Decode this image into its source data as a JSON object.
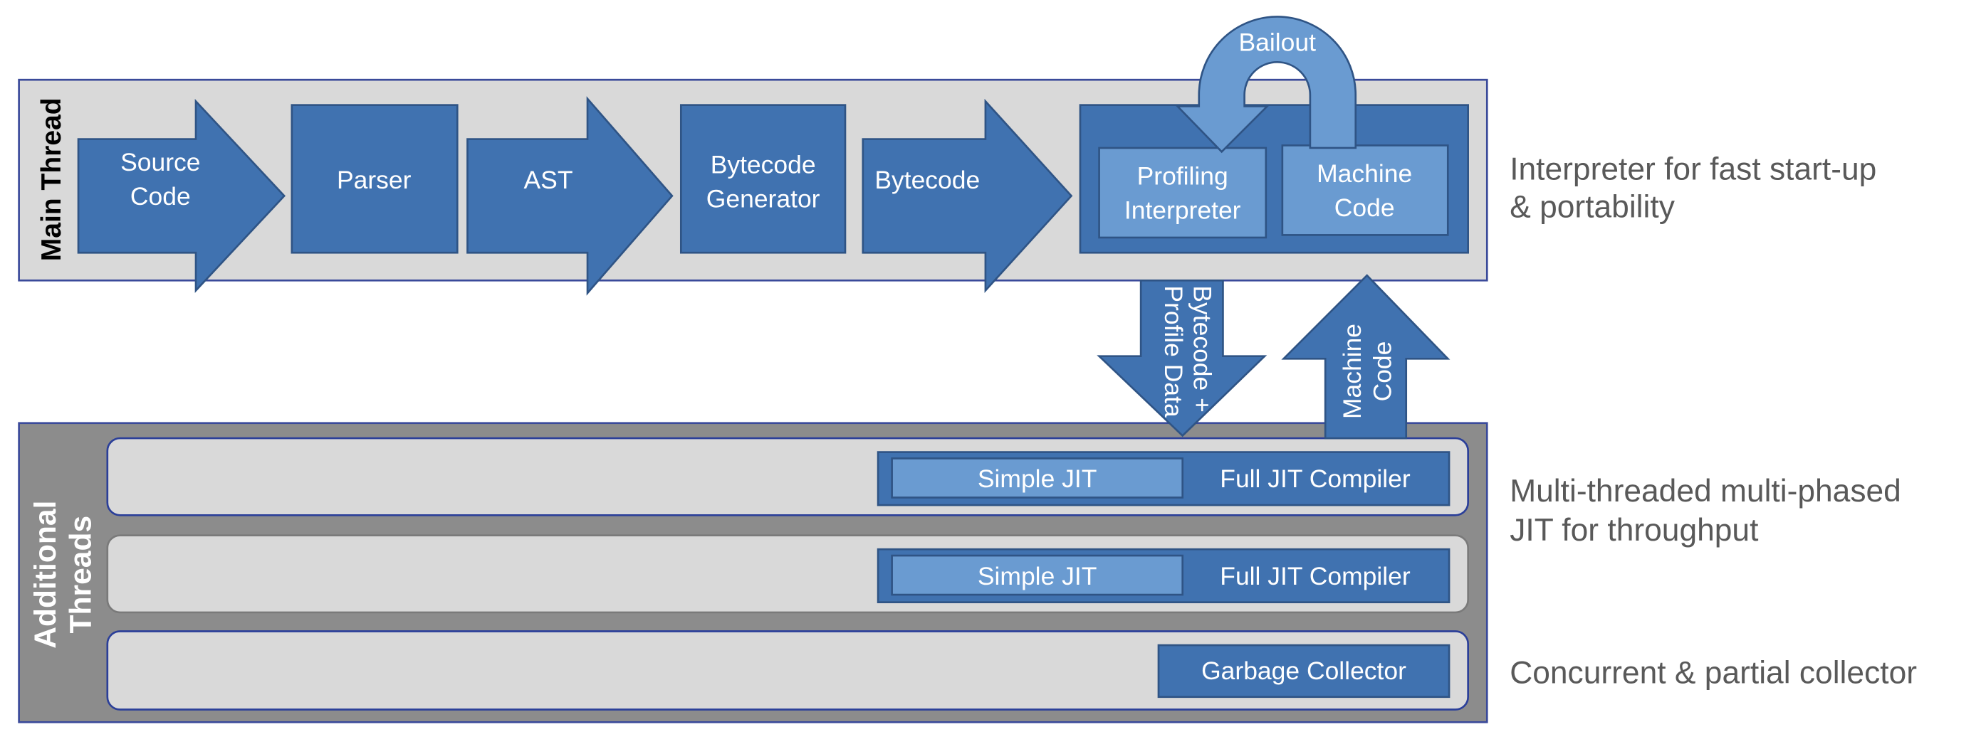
{
  "colors": {
    "block_blue": "#4072b0",
    "light_blue": "#6a9bd1",
    "panel_gray": "#d9d9d9",
    "additional_threads_gray": "#8c8c8c",
    "frame_border": "#3a4a9a",
    "note_text": "#595959"
  },
  "main_thread": {
    "label": "Main Thread",
    "pipeline": {
      "source_code": [
        "Source",
        "Code"
      ],
      "parser": "Parser",
      "ast": "AST",
      "bytecode_generator": [
        "Bytecode",
        "Generator"
      ],
      "bytecode": "Bytecode"
    },
    "execution": {
      "profiling_interpreter": [
        "Profiling",
        "Interpreter"
      ],
      "machine_code": [
        "Machine",
        "Code"
      ],
      "bailout": "Bailout"
    }
  },
  "transfer": {
    "down": [
      "Bytecode +",
      "Profile Data"
    ],
    "up": [
      "Machine",
      "Code"
    ]
  },
  "additional_threads": {
    "label": [
      "Additional",
      "Threads"
    ],
    "rows": [
      {
        "simple_jit": "Simple JIT",
        "full_jit": "Full JIT Compiler"
      },
      {
        "simple_jit": "Simple JIT",
        "full_jit": "Full JIT Compiler"
      },
      {
        "garbage_collector": "Garbage Collector"
      }
    ]
  },
  "notes": {
    "interpreter": [
      "Interpreter for fast start-up",
      "& portability"
    ],
    "jit": [
      "Multi-threaded multi-phased",
      "JIT for throughput"
    ],
    "gc": "Concurrent & partial collector"
  }
}
